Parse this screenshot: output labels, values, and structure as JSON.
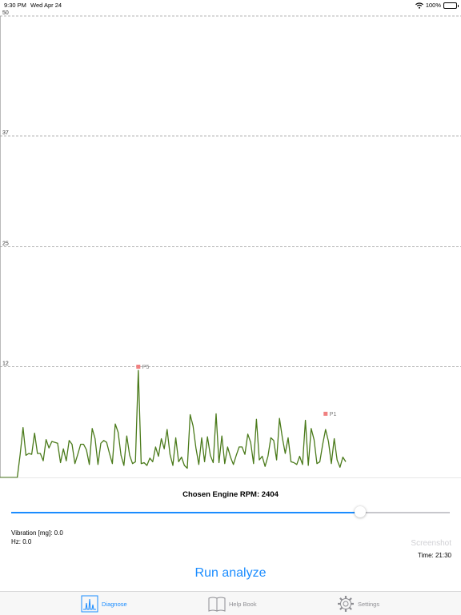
{
  "status_bar": {
    "time": "9:30 PM",
    "date": "Wed Apr 24",
    "battery": "100%"
  },
  "chart_data": {
    "type": "line",
    "yaxis": {
      "ticks": [
        "50",
        "37",
        "25",
        "12"
      ],
      "tick_values": [
        50,
        37,
        25,
        12
      ],
      "ylim": [
        0,
        50
      ]
    },
    "grid": true,
    "line_color": "#4a7a1a",
    "marker_color": "#f08080",
    "x": [
      0,
      1,
      2,
      3,
      4,
      5,
      6,
      7,
      8,
      9,
      10,
      11,
      12,
      13,
      14,
      15,
      16,
      17,
      18,
      19,
      20,
      21,
      22,
      23,
      24,
      25,
      26,
      27,
      28,
      29,
      30,
      31,
      32,
      33,
      34,
      35,
      36,
      37,
      38,
      39,
      40,
      41,
      42,
      43,
      44,
      45,
      46,
      47,
      48,
      49,
      50,
      51,
      52,
      53,
      54,
      55,
      56,
      57,
      58,
      59,
      60,
      61,
      62,
      63,
      64,
      65,
      66,
      67,
      68,
      69,
      70,
      71,
      72,
      73,
      74,
      75,
      76,
      77,
      78,
      79,
      80,
      81,
      82,
      83,
      84,
      85,
      86,
      87,
      88,
      89,
      90,
      91,
      92,
      93,
      94,
      95,
      96,
      97,
      98,
      99,
      100,
      101,
      102,
      103,
      104,
      105,
      106,
      107,
      108,
      109,
      110,
      111,
      112,
      113,
      114,
      115,
      116,
      117,
      118,
      119,
      120,
      121,
      122,
      123,
      124,
      125,
      126,
      127,
      128,
      129,
      130,
      131,
      132,
      133,
      134,
      135,
      136,
      137,
      138,
      139,
      140,
      141,
      142,
      143,
      144,
      145,
      146,
      147,
      148,
      149,
      150,
      151,
      152,
      153,
      154,
      155,
      156,
      157,
      158,
      159,
      160
    ],
    "values": [
      0,
      0,
      0,
      0,
      0,
      0,
      0,
      2.5,
      5.4,
      2.4,
      2.6,
      2.5,
      4.8,
      2.6,
      2.6,
      1.8,
      4.1,
      3.2,
      3.9,
      3.8,
      3.7,
      1.6,
      3.1,
      1.8,
      4.0,
      3.6,
      1.5,
      2.5,
      3.6,
      3.6,
      3.0,
      1.4,
      5.3,
      4.2,
      1.4,
      3.7,
      4.0,
      3.8,
      2.6,
      1.5,
      5.8,
      4.9,
      2.4,
      1.3,
      4.5,
      2.4,
      1.5,
      1.7,
      11.6,
      1.5,
      1.6,
      1.3,
      2.1,
      1.7,
      3.3,
      2.3,
      4.2,
      3.1,
      5.2,
      2.5,
      1.3,
      4.3,
      1.7,
      2.2,
      1.3,
      1.0,
      6.8,
      5.6,
      3.2,
      1.4,
      4.3,
      1.7,
      4.4,
      2.4,
      1.6,
      6.9,
      1.6,
      4.5,
      1.5,
      3.3,
      2.2,
      1.4,
      2.4,
      3.3,
      3.3,
      2.5,
      4.7,
      3.8,
      1.5,
      6.3,
      1.9,
      2.3,
      1.2,
      2.3,
      4.3,
      4.0,
      1.9,
      6.4,
      4.3,
      2.6,
      4.3,
      1.7,
      1.6,
      1.4,
      2.3,
      1.4,
      6.2,
      1.3,
      5.3,
      4.1,
      1.5,
      1.7,
      3.6,
      5.2,
      3.9,
      1.5,
      4.2,
      1.9,
      1.1,
      2.2,
      1.7
    ],
    "markers": [
      {
        "label": "P5",
        "x": 48,
        "y": 12
      },
      {
        "label": "P1",
        "x": 113,
        "y": 6.9
      }
    ]
  },
  "controls": {
    "rpm_label": "Chosen Engine RPM: 2404",
    "slider_fraction": 0.795,
    "vibration": "Vibration [mg]: 0.0",
    "hz": "Hz: 0.0",
    "screenshot_label": "Screenshot",
    "time": "Time: 21:30",
    "run_label": "Run analyze"
  },
  "tabbar": {
    "items": [
      {
        "label": "Diagnose",
        "icon": "waveform-icon",
        "active": true
      },
      {
        "label": "Help Book",
        "icon": "book-icon",
        "active": false
      },
      {
        "label": "Settings",
        "icon": "gear-icon",
        "active": false
      }
    ],
    "active_color": "#1a8cff",
    "inactive_color": "#8e8e93"
  }
}
